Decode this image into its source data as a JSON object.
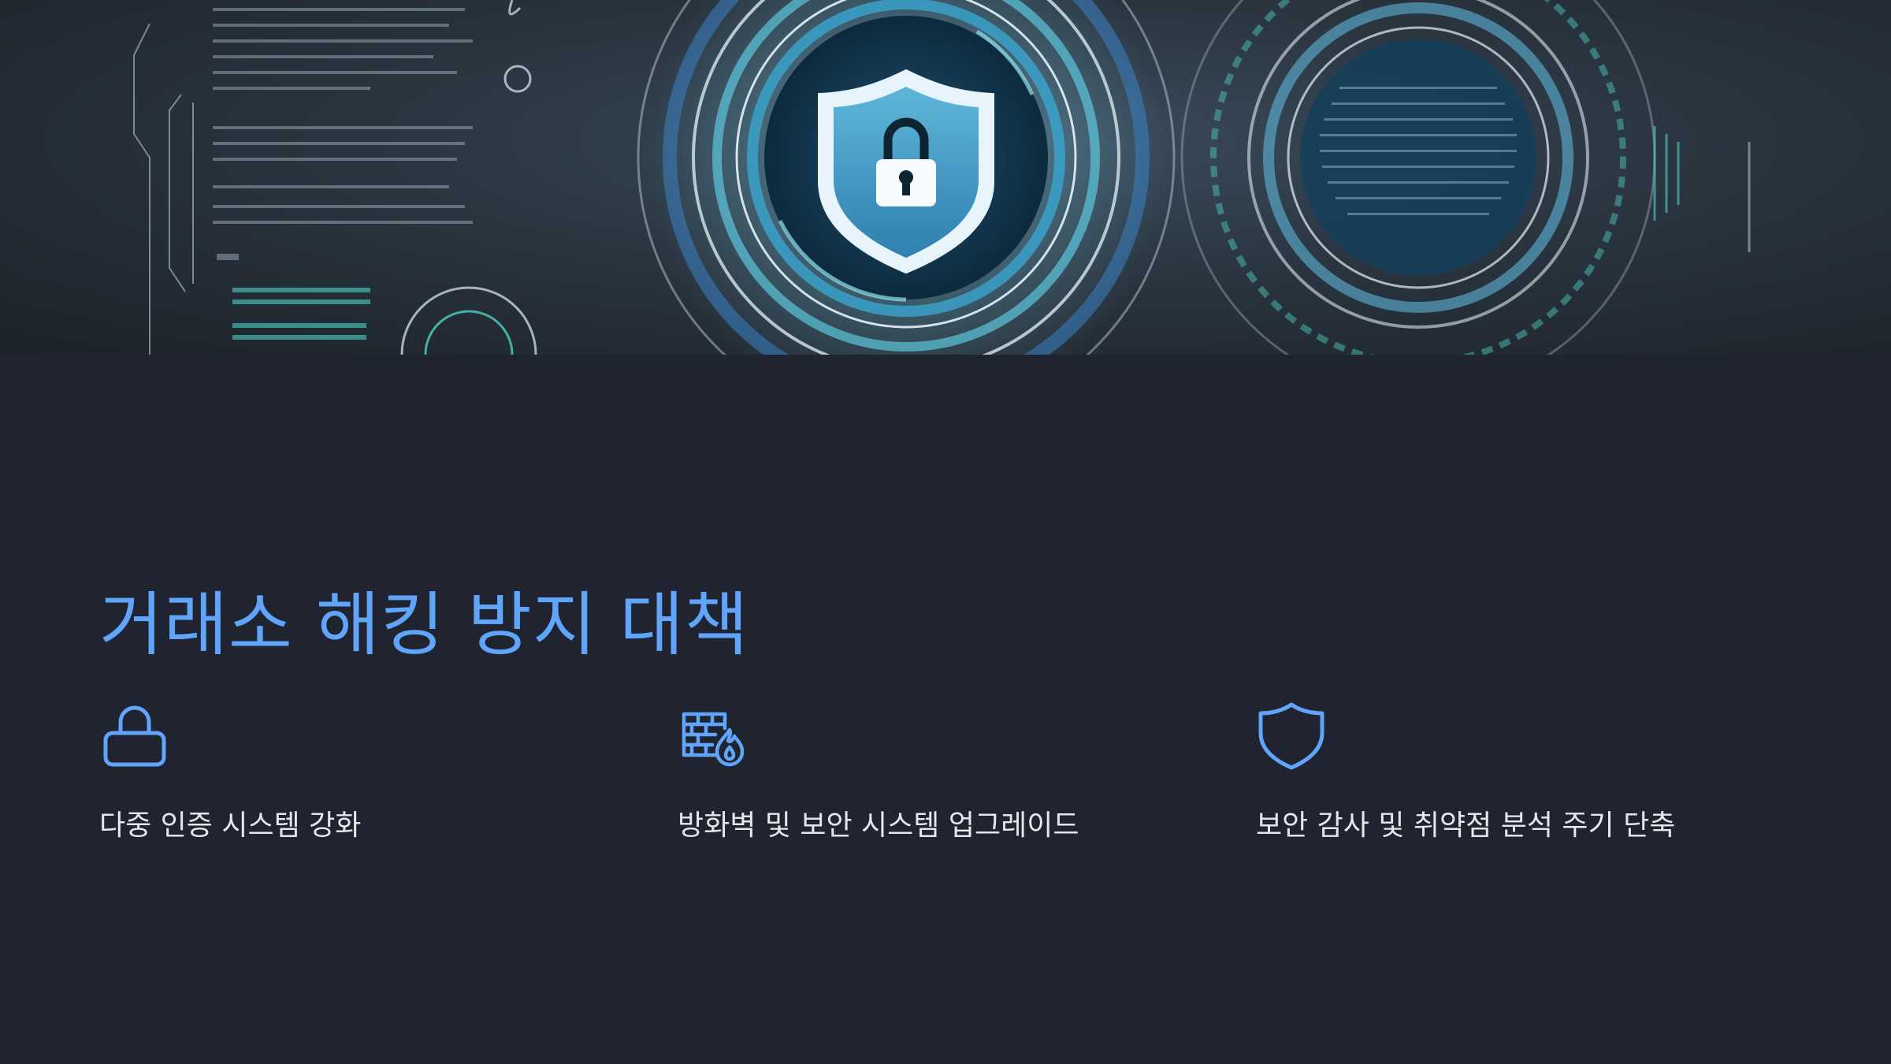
{
  "hero": {
    "image_icon": "cybersecurity-shield-lock-illustration"
  },
  "title": "거래소 해킹 방지 대책",
  "features": [
    {
      "icon": "lock-icon",
      "label": "다중 인증 시스템 강화"
    },
    {
      "icon": "firewall-icon",
      "label": "방화벽 및 보안 시스템 업그레이드"
    },
    {
      "icon": "shield-icon",
      "label": "보안 감사 및 취약점 분석 주기 단축"
    }
  ],
  "colors": {
    "background": "#1f2430",
    "accent": "#60a5fa",
    "text": "#e5e7eb"
  }
}
